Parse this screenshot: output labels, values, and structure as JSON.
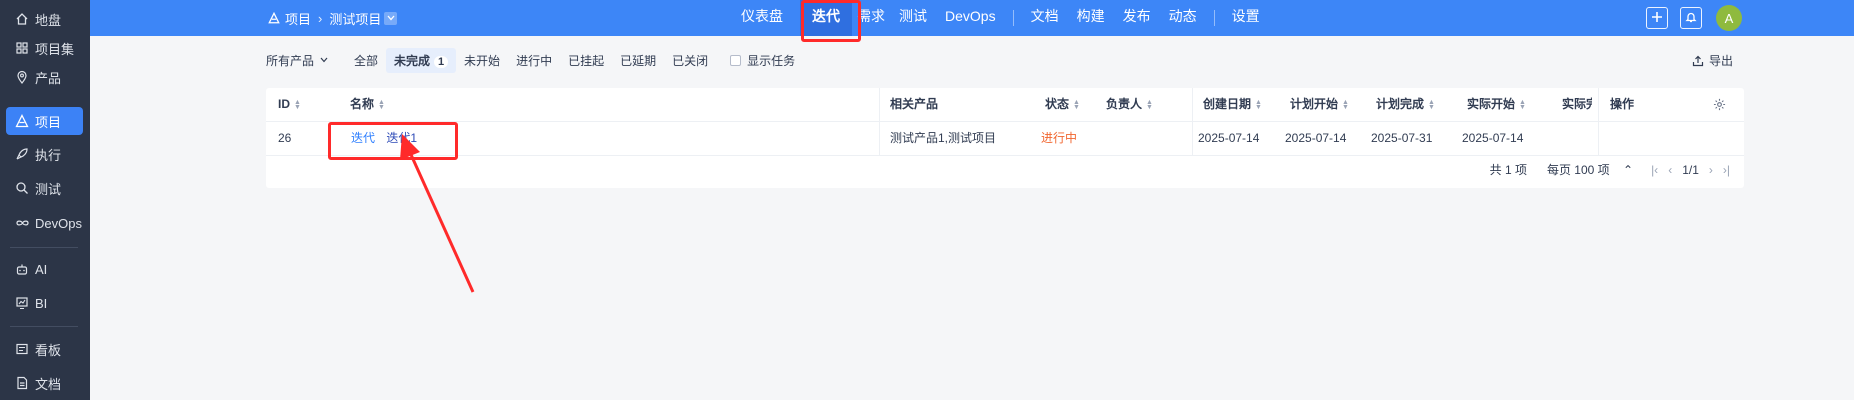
{
  "sidebar": {
    "items": [
      {
        "label": "地盘",
        "icon": "home-icon"
      },
      {
        "label": "项目集",
        "icon": "grid-icon"
      },
      {
        "label": "产品",
        "icon": "location-icon"
      },
      {
        "label": "项目",
        "icon": "project-icon"
      },
      {
        "label": "执行",
        "icon": "rocket-icon"
      },
      {
        "label": "测试",
        "icon": "search-icon"
      },
      {
        "label": "DevOps",
        "icon": "infinity-icon"
      },
      {
        "label": "AI",
        "icon": "robot-icon"
      },
      {
        "label": "BI",
        "icon": "chart-icon"
      },
      {
        "label": "看板",
        "icon": "board-icon"
      },
      {
        "label": "文档",
        "icon": "document-icon"
      }
    ]
  },
  "header": {
    "breadcrumb": [
      "项目",
      "测试项目"
    ],
    "nav": [
      "仪表盘",
      "迭代",
      "需求",
      "测试",
      "DevOps",
      "文档",
      "构建",
      "发布",
      "动态",
      "设置"
    ],
    "active_nav": "迭代",
    "avatar": "A"
  },
  "filters": {
    "product": "所有产品",
    "tabs": [
      "全部",
      "未完成",
      "未开始",
      "进行中",
      "已挂起",
      "已延期",
      "已关闭"
    ],
    "active_tab": "未完成",
    "active_count": "1",
    "show_tasks": "显示任务",
    "export": "导出"
  },
  "table": {
    "columns": [
      "ID",
      "名称",
      "相关产品",
      "状态",
      "负责人",
      "创建日期",
      "计划开始",
      "计划完成",
      "实际开始",
      "实际完成",
      "操作"
    ],
    "rows": [
      {
        "id": "26",
        "type": "迭代",
        "name": "迭代1",
        "products": "测试产品1,测试项目",
        "status": "进行中",
        "owner": "",
        "created": "2025-07-14",
        "plan_start": "2025-07-14",
        "plan_end": "2025-07-31",
        "actual_start": "2025-07-14",
        "actual_end": "",
        "actions": ""
      }
    ],
    "pager": {
      "total": "共 1 项",
      "per_page": "每页 100 项",
      "page": "1/1"
    }
  },
  "colors": {
    "accent": "#3d86f7",
    "status_active": "#f1662f",
    "annotation": "#ff2a2a",
    "sidebar_bg": "#2c3547"
  }
}
